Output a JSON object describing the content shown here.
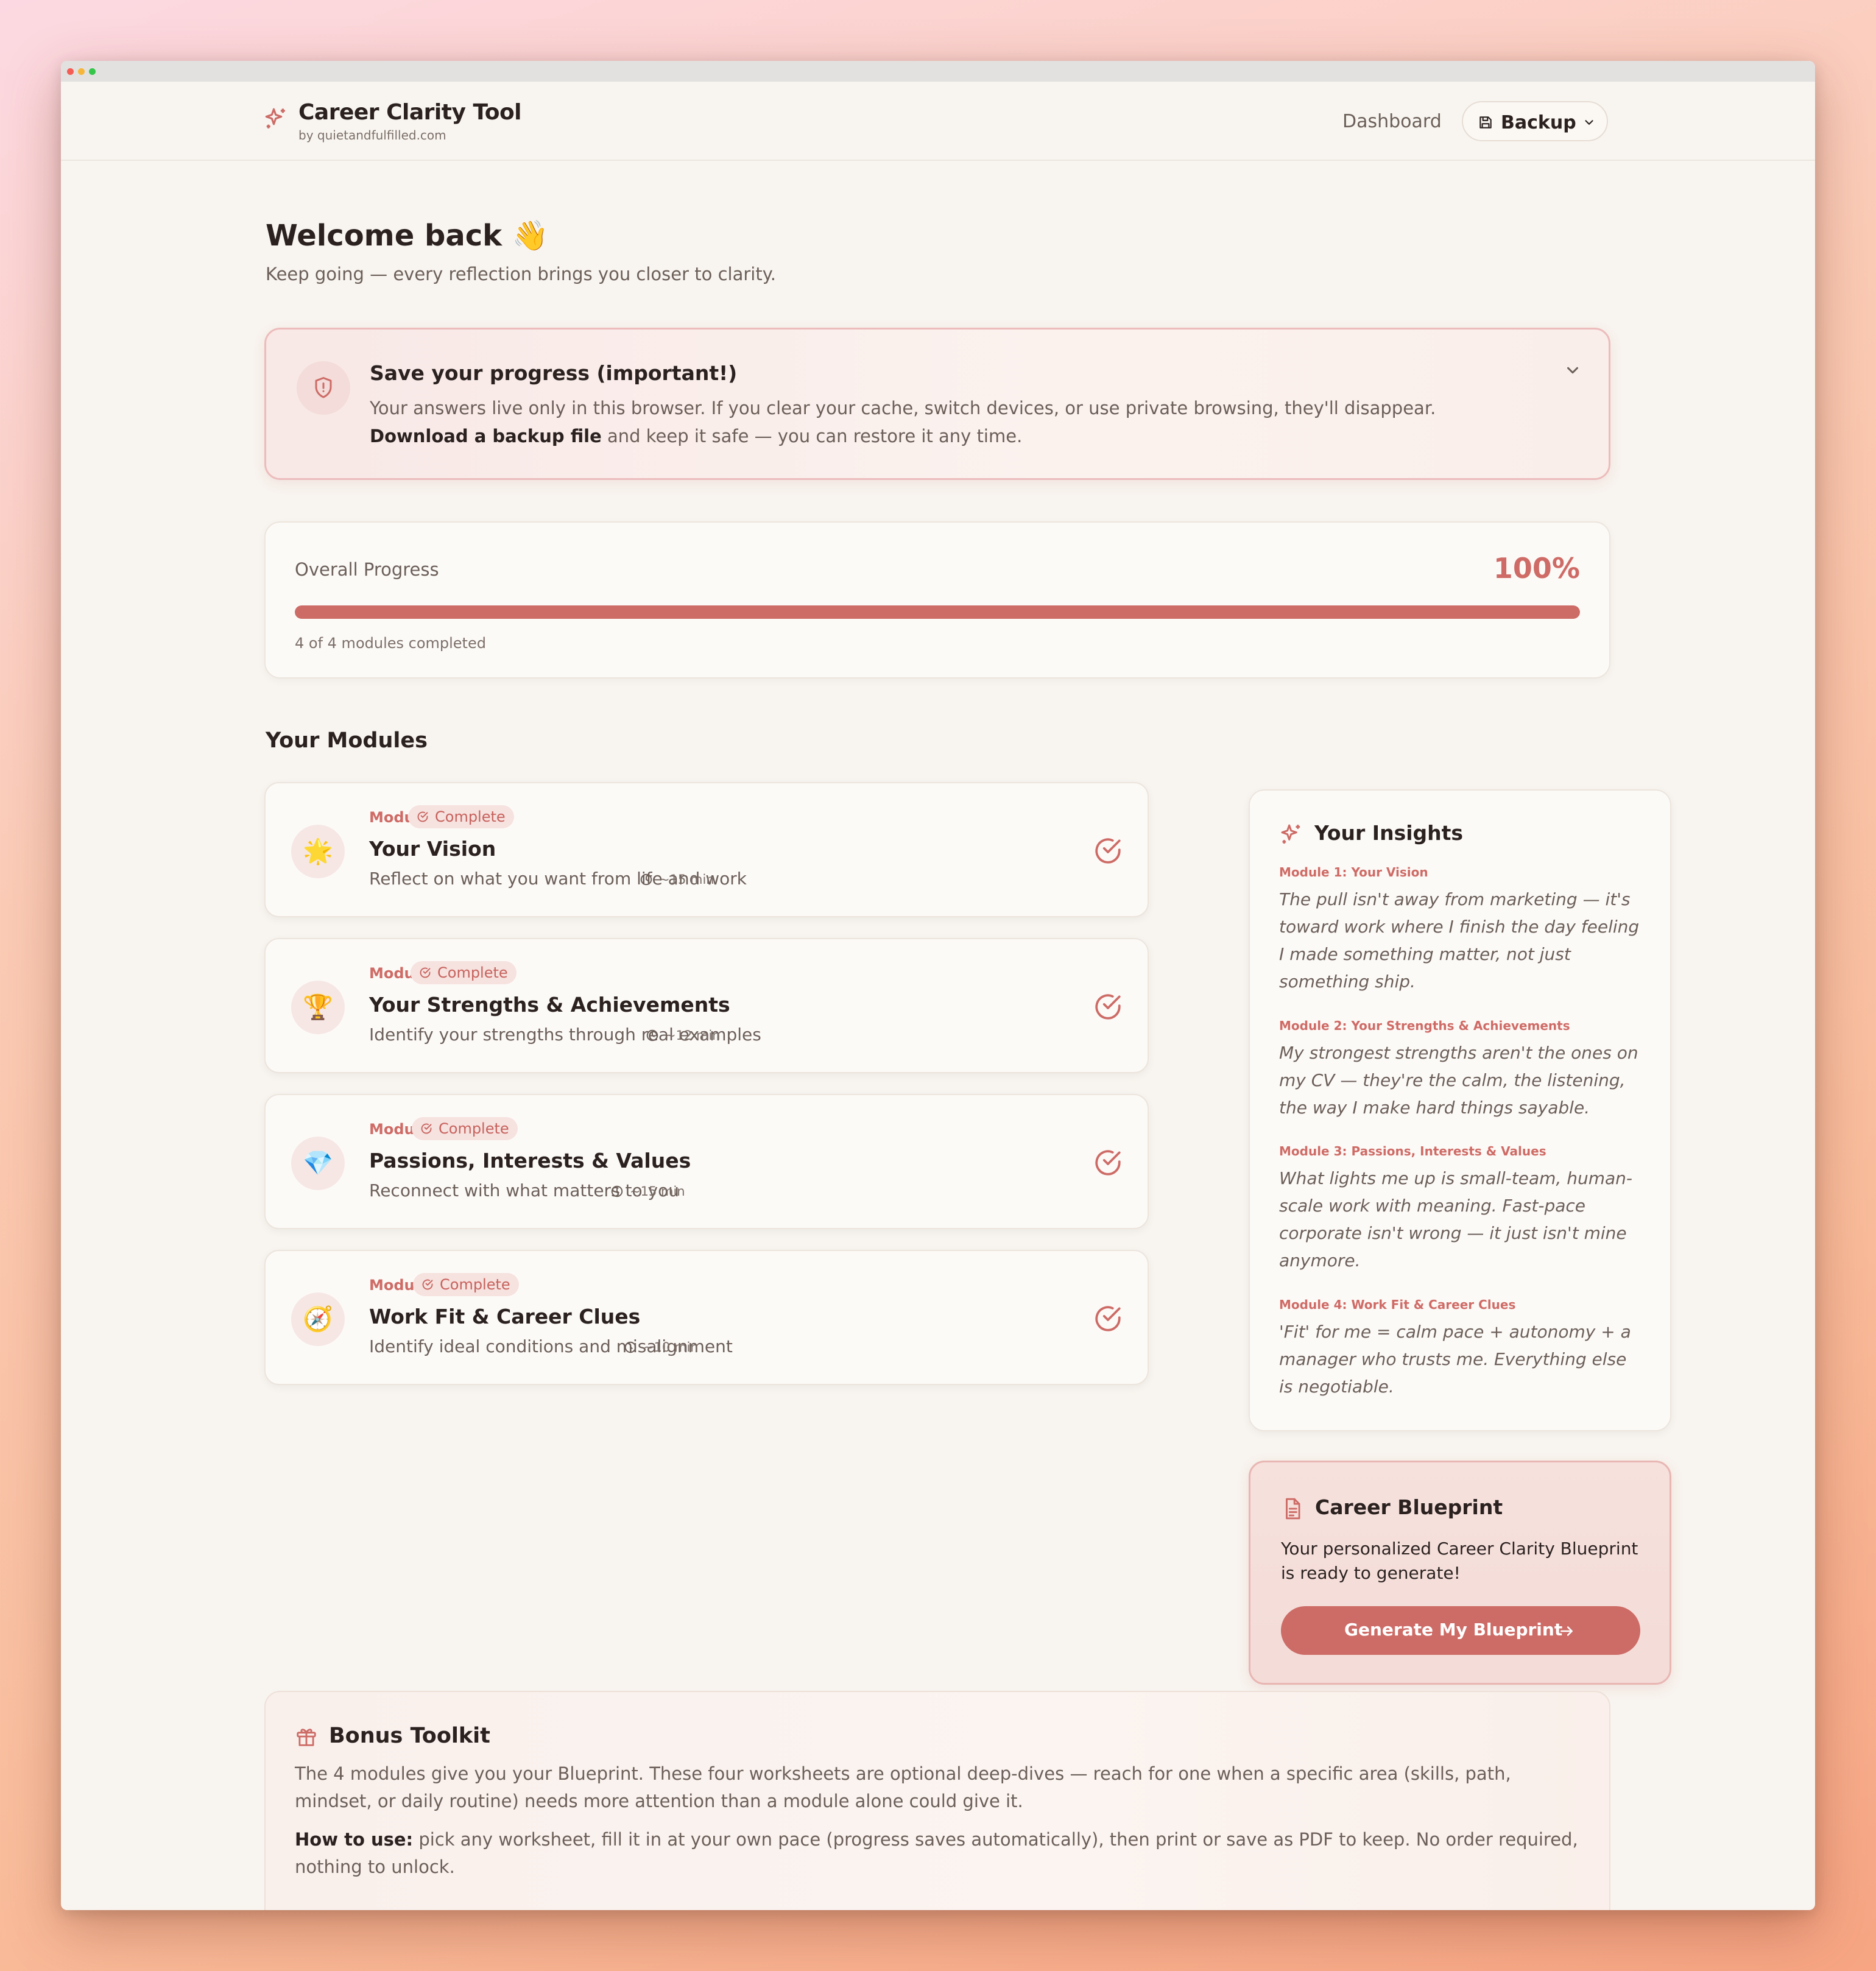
{
  "brand": {
    "title": "Career Clarity Tool",
    "subtitle": "by quietandfulfilled.com"
  },
  "nav": {
    "dashboard_label": "Dashboard",
    "backup_label": "Backup"
  },
  "welcome": {
    "title": "Welcome back 👋",
    "subtitle": "Keep going — every reflection brings you closer to clarity."
  },
  "save_notice": {
    "title": "Save your progress (important!)",
    "body_start": "Your answers live only in this browser. If you clear your cache, switch devices, or use private browsing, they'll disappear. ",
    "body_bold": "Download a backup file",
    "body_end": " and keep it safe — you can restore it any time."
  },
  "progress": {
    "label": "Overall Progress",
    "percent_text": "100%",
    "fraction": 1.0,
    "count_text": "4 of 4 modules completed"
  },
  "modules_heading": "Your Modules",
  "modules": [
    {
      "number": "Module 1",
      "status": "Complete",
      "emoji": "🌟",
      "title": "Your Vision",
      "description": "Reflect on what you want from life and work",
      "time": "~15 min"
    },
    {
      "number": "Module 2",
      "status": "Complete",
      "emoji": "🏆",
      "title": "Your Strengths & Achievements",
      "description": "Identify your strengths through real examples",
      "time": "~12 min"
    },
    {
      "number": "Module 3",
      "status": "Complete",
      "emoji": "💎",
      "title": "Passions, Interests & Values",
      "description": "Reconnect with what matters to you",
      "time": "~15 min"
    },
    {
      "number": "Module 4",
      "status": "Complete",
      "emoji": "🧭",
      "title": "Work Fit & Career Clues",
      "description": "Identify ideal conditions and misalignment",
      "time": "~10 min"
    }
  ],
  "insights": {
    "title": "Your Insights",
    "items": [
      {
        "label": "Module 1: Your Vision",
        "quote": "The pull isn't away from marketing — it's toward work where I finish the day feeling I made something matter, not just something ship."
      },
      {
        "label": "Module 2: Your Strengths & Achievements",
        "quote": "My strongest strengths aren't the ones on my CV — they're the calm, the listening, the way I make hard things sayable."
      },
      {
        "label": "Module 3: Passions, Interests & Values",
        "quote": "What lights me up is small-team, human-scale work with meaning. Fast-pace corporate isn't wrong — it just isn't mine anymore."
      },
      {
        "label": "Module 4: Work Fit & Career Clues",
        "quote": "'Fit' for me = calm pace + autonomy + a manager who trusts me. Everything else is negotiable."
      }
    ]
  },
  "blueprint": {
    "title": "Career Blueprint",
    "body": "Your personalized Career Clarity Blueprint is ready to generate!",
    "button_label": "Generate My Blueprint"
  },
  "bonus": {
    "title": "Bonus Toolkit",
    "body": "The 4 modules give you your Blueprint. These four worksheets are optional deep-dives — reach for one when a specific area (skills, path, mindset, or daily routine) needs more attention than a module alone could give it.",
    "how_label": "How to use:",
    "how_text": " pick any worksheet, fill it in at your own pace (progress saves automatically), then print or save as PDF to keep. No order required, nothing to unlock."
  },
  "colors": {
    "accent": "#cd6b66",
    "background": "#f8f4ef",
    "text": "#2b2220",
    "muted": "#6c5f59"
  },
  "icons": {
    "brand": "sparkles-icon",
    "backup": "floppy-disk-icon",
    "save_notice": "shield-alert-icon",
    "module_status": "circle-check-icon",
    "module_time": "clock-icon",
    "insights": "sparkles-icon",
    "blueprint": "document-icon",
    "bonus": "gift-icon"
  }
}
